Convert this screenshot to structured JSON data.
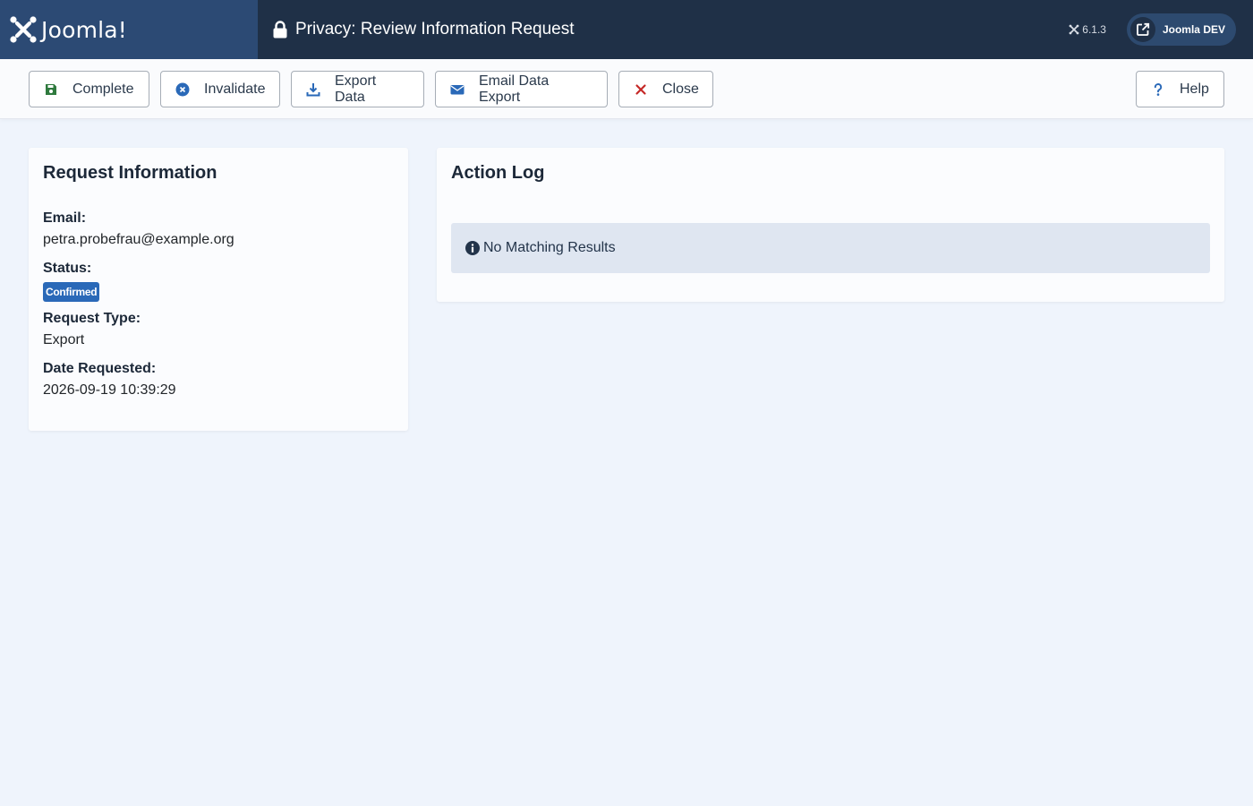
{
  "header": {
    "logo_text": "Joomla!",
    "title": "Privacy: Review Information Request",
    "version": "6.1.3",
    "site_button_label": "Joomla DEV"
  },
  "toolbar": {
    "complete_label": "Complete",
    "invalidate_label": "Invalidate",
    "export_label": "Export Data",
    "email_export_label": "Email Data Export",
    "close_label": "Close",
    "help_label": "Help"
  },
  "request_info": {
    "title": "Request Information",
    "email_label": "Email:",
    "email_value": "petra.probefrau@example.org",
    "status_label": "Status:",
    "status_value": "Confirmed",
    "type_label": "Request Type:",
    "type_value": "Export",
    "date_label": "Date Requested:",
    "date_value": "2026-09-19 10:39:29"
  },
  "action_log": {
    "title": "Action Log",
    "empty_message": "No Matching Results"
  },
  "colors": {
    "header_bg": "#1f3047",
    "logo_bg": "#2c4a74",
    "badge_bg": "#2a69b8",
    "page_bg": "#eff4fc",
    "complete_icon": "#2f7a3e",
    "invalidate_icon": "#2a69b8",
    "close_icon": "#c52827"
  },
  "icons": {
    "logo": "joomla-logo-icon",
    "title": "lock-icon",
    "version": "joomla-small-icon",
    "site": "external-link-icon",
    "complete": "save-icon",
    "invalidate": "times-circle-icon",
    "export": "download-icon",
    "email": "envelope-icon",
    "close": "times-icon",
    "help": "question-icon",
    "alert": "info-circle-icon"
  }
}
